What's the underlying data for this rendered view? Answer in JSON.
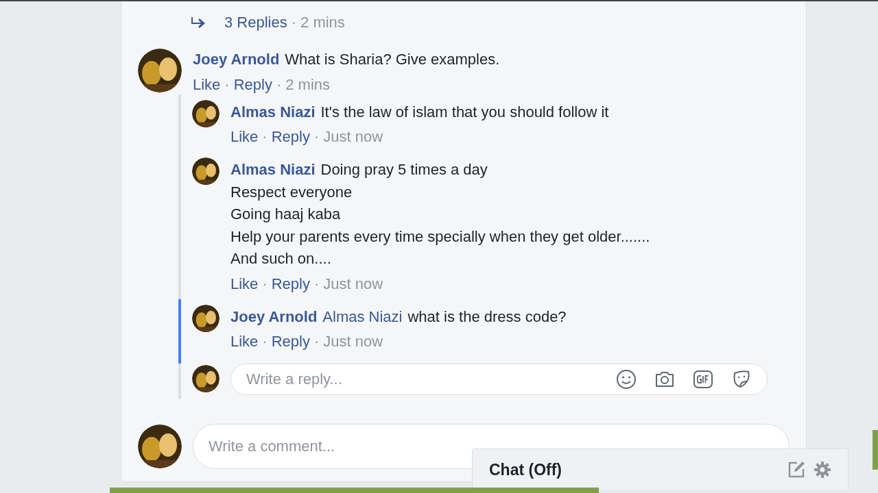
{
  "separator": "·",
  "replies_link": {
    "label": "3 Replies",
    "time": "2 mins"
  },
  "comment": {
    "author": "Joey Arnold",
    "text": "What is Sharia? Give examples.",
    "actions": [
      "Like",
      "Reply"
    ],
    "time": "2 mins"
  },
  "replies": [
    {
      "author": "Almas Niazi",
      "highlighted": false,
      "lines": [
        "It's the law of islam that you should follow it"
      ],
      "actions": [
        "Like",
        "Reply"
      ],
      "time": "Just now"
    },
    {
      "author": "Almas Niazi",
      "highlighted": false,
      "lines": [
        "Doing pray 5 times a day",
        "Respect everyone",
        "Going haaj kaba",
        "Help your parents every time specially when they get older.......",
        "And such on...."
      ],
      "actions": [
        "Like",
        "Reply"
      ],
      "time": "Just now"
    },
    {
      "author": "Joey Arnold",
      "highlighted": true,
      "mention": "Almas Niazi",
      "lines": [
        "what is the dress code?"
      ],
      "actions": [
        "Like",
        "Reply"
      ],
      "time": "Just now"
    }
  ],
  "reply_box": {
    "placeholder": "Write a reply..."
  },
  "comment_box": {
    "placeholder": "Write a comment..."
  },
  "chat": {
    "label": "Chat (Off)"
  }
}
